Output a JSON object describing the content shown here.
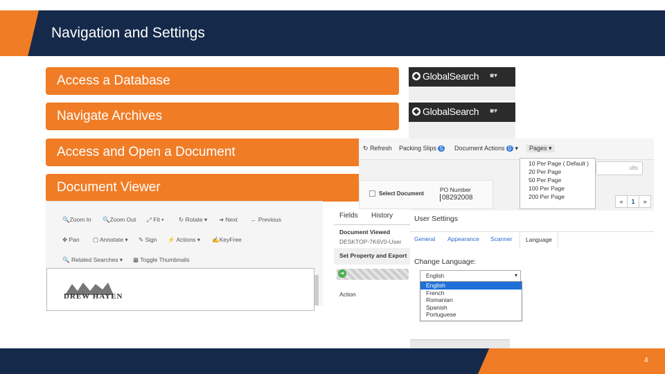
{
  "slide": {
    "title": "Navigation and Settings",
    "page_number": "4"
  },
  "items": [
    {
      "label": "Access a Database"
    },
    {
      "label": "Navigate Archives"
    },
    {
      "label": "Access and Open a Document"
    },
    {
      "label": "Document Viewer"
    }
  ],
  "global_search": {
    "brand": "GlobalSearch"
  },
  "toolbar": {
    "refresh": "Refresh",
    "packing_slips": "Packing Slips",
    "packing_slips_count": "5",
    "document_actions": "Document Actions",
    "document_actions_count": "0",
    "pages": "Pages",
    "pages_options": [
      "10 Per Page ( Default )",
      "20 Per Page",
      "50 Per Page",
      "100 Per Page",
      "200 Per Page"
    ],
    "results_suffix": "ults",
    "select_document": "Select Document",
    "po_number_label": "PO Number",
    "po_number_value": "08292008",
    "pager_prev": "«",
    "pager_current": "1",
    "pager_next": "»"
  },
  "viewer": {
    "zoom_in": "Zoom In",
    "zoom_out": "Zoom Out",
    "fit": "Fit",
    "rotate": "Rotate",
    "next": "Next",
    "previous": "Previous",
    "pan": "Pan",
    "annotate": "Annotate",
    "sign": "Sign",
    "actions": "Actions",
    "keyfree": "KeyFree",
    "related_searches": "Related Searches",
    "toggle_thumbnails": "Toggle Thumbnails",
    "doc_logo_text": "DREW HAYEN"
  },
  "fields_panel": {
    "fields_tab": "Fields",
    "history_tab": "History",
    "document_viewed": "Document Viewed",
    "user_line": "DESKTOP-7K6V0-User",
    "set_property": "Set Property and Export",
    "action": "Action"
  },
  "user_settings": {
    "title": "User Settings",
    "tabs": [
      "General",
      "Appearance",
      "Scanner",
      "Language"
    ],
    "change_language": "Change Language:",
    "selected": "English",
    "options": [
      "English",
      "French",
      "Romanian",
      "Spanish",
      "Portuguese"
    ]
  },
  "colors": {
    "navy": "#15294a",
    "orange": "#f07c26",
    "selection": "#1e6fd9"
  }
}
